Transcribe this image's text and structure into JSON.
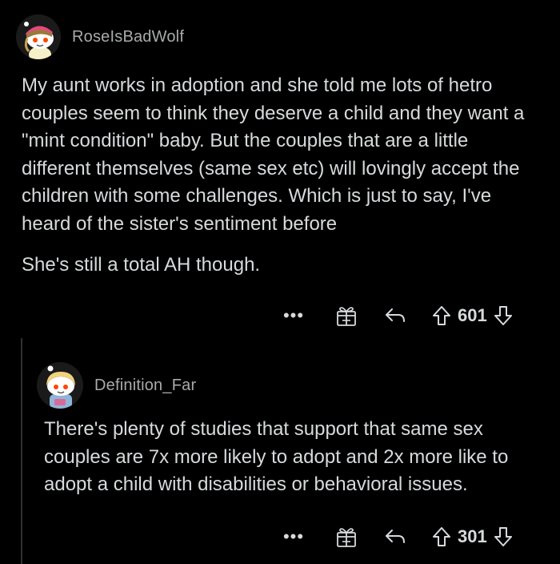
{
  "comments": [
    {
      "username": "RoseIsBadWolf",
      "paragraphs": [
        "My aunt works in adoption and she told me lots of hetro couples seem to think they deserve a child and they want a \"mint condition\" baby. But the couples that are a little different themselves (same sex etc) will lovingly accept the children with some challenges. Which is just to say, I've heard of the sister's sentiment before",
        "She's still a total AH though."
      ],
      "more_label": "•••",
      "score": "601"
    },
    {
      "username": "Definition_Far",
      "paragraphs": [
        "There's plenty of studies that support that same sex couples are 7x more likely to adopt and 2x more like to adopt a child with disabilities or behavioral issues."
      ],
      "more_label": "•••",
      "score": "301"
    }
  ],
  "icons": {
    "more": "more-options-icon",
    "award": "gift-award-icon",
    "reply": "reply-arrow-icon",
    "upvote": "upvote-arrow-icon",
    "downvote": "downvote-arrow-icon"
  },
  "colors": {
    "background": "#000000",
    "text": "#d7dadc",
    "username": "#a8aaab",
    "thread_line": "#2f3031"
  }
}
